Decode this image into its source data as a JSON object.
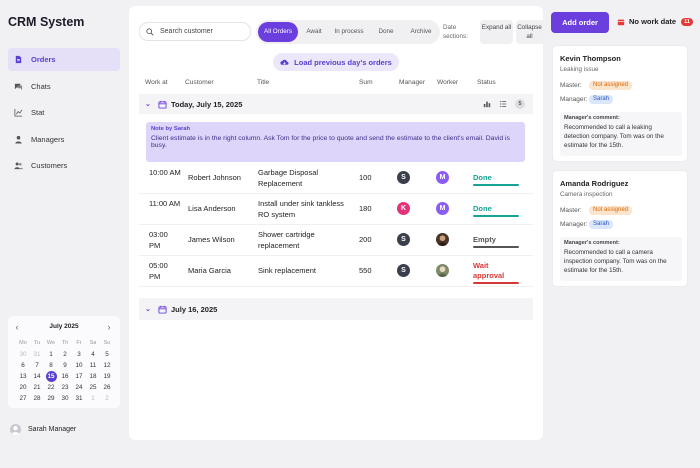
{
  "app": {
    "title": "CRM System"
  },
  "sidebar": {
    "items": [
      {
        "label": "Orders",
        "icon": "document-icon",
        "active": true
      },
      {
        "label": "Chats",
        "icon": "chat-icon",
        "active": false
      },
      {
        "label": "Stat",
        "icon": "chart-icon",
        "active": false
      },
      {
        "label": "Managers",
        "icon": "person-icon",
        "active": false
      },
      {
        "label": "Customers",
        "icon": "people-icon",
        "active": false
      }
    ]
  },
  "calendar": {
    "month": "July 2025",
    "weekdays": [
      "Mo",
      "Tu",
      "We",
      "Th",
      "Fr",
      "Sa",
      "Su"
    ],
    "weeks": [
      [
        "30",
        "31",
        "1",
        "2",
        "3",
        "4",
        "5"
      ],
      [
        "6",
        "7",
        "8",
        "9",
        "10",
        "11",
        "12"
      ],
      [
        "13",
        "14",
        "15",
        "16",
        "17",
        "18",
        "19"
      ],
      [
        "20",
        "21",
        "22",
        "23",
        "24",
        "25",
        "26"
      ],
      [
        "27",
        "28",
        "29",
        "30",
        "31",
        "1",
        "2"
      ]
    ],
    "selected": "15"
  },
  "user": {
    "name": "Sarah Manager"
  },
  "toolbar": {
    "search_placeholder": "Search customer",
    "filters": [
      {
        "label": "All Orders",
        "active": true
      },
      {
        "label": "Await",
        "active": false
      },
      {
        "label": "In process",
        "active": false
      },
      {
        "label": "Done",
        "active": false
      },
      {
        "label": "Archive",
        "active": false
      }
    ],
    "sections_label": "Date sections:",
    "expand_label": "Expand all",
    "collapse_label": "Collapse all"
  },
  "load_previous_label": "Load previous day's orders",
  "table": {
    "columns": [
      "Work at",
      "Customer",
      "Title",
      "Sum",
      "Manager",
      "Worker",
      "Status"
    ]
  },
  "days": [
    {
      "label": "Today, July 15, 2025",
      "count": "5"
    },
    {
      "label": "July 16, 2025"
    }
  ],
  "note": {
    "title": "Note by Sarah",
    "text": "Client estimate is in the right column. Ask Tom for the price to quote and send the estimate to the client's email. David is busy."
  },
  "orders": [
    {
      "time": "10:00 AM",
      "customer": "Robert Johnson",
      "title": "Garbage Disposal Replacement",
      "sum": "100",
      "manager": "S",
      "manager_color": "#3a3f4b",
      "worker": "M",
      "worker_color": "#8b5cf6",
      "status": "Done",
      "status_color": "#16a394"
    },
    {
      "time": "11:00 AM",
      "customer": "Lisa Anderson",
      "title": "Install under sink tankless RO system",
      "sum": "180",
      "manager": "K",
      "manager_color": "#e2337a",
      "worker": "M",
      "worker_color": "#8b5cf6",
      "status": "Done",
      "status_color": "#16a394"
    },
    {
      "time": "03:00 PM",
      "customer": "James Wilson",
      "title": "Shower cartridge replacement",
      "sum": "200",
      "manager": "S",
      "manager_color": "#3a3f4b",
      "worker": "",
      "worker_color": "#4a3328",
      "status": "Empty",
      "status_color": "#555555"
    },
    {
      "time": "05:00 PM",
      "customer": "Maria Garcia",
      "title": "Sink replacement",
      "sum": "550",
      "manager": "S",
      "manager_color": "#3a3f4b",
      "worker": "",
      "worker_color": "#7d8a6a",
      "status": "Wait approval",
      "status_color": "#d63939"
    }
  ],
  "header_actions": {
    "add_order_label": "Add order",
    "no_work_label": "No work date",
    "no_work_count": "11"
  },
  "cards": [
    {
      "name": "Kevin Thompson",
      "subtitle": "Leaking issue",
      "master_label": "Master:",
      "master_value": "Not assigned",
      "manager_label": "Manager:",
      "manager_value": "Sarah",
      "comment_title": "Manager's comment:",
      "comment": "Recommended to call a leaking detection company. Tom was on the estimate for the 15th."
    },
    {
      "name": "Amanda Rodriguez",
      "subtitle": "Camera inspection",
      "master_label": "Master:",
      "master_value": "Not assigned",
      "manager_label": "Manager:",
      "manager_value": "Sarah",
      "comment_title": "Manager's comment:",
      "comment": "Recommended to call a camera inspection company. Tom was on the estimate for the 15th."
    }
  ]
}
